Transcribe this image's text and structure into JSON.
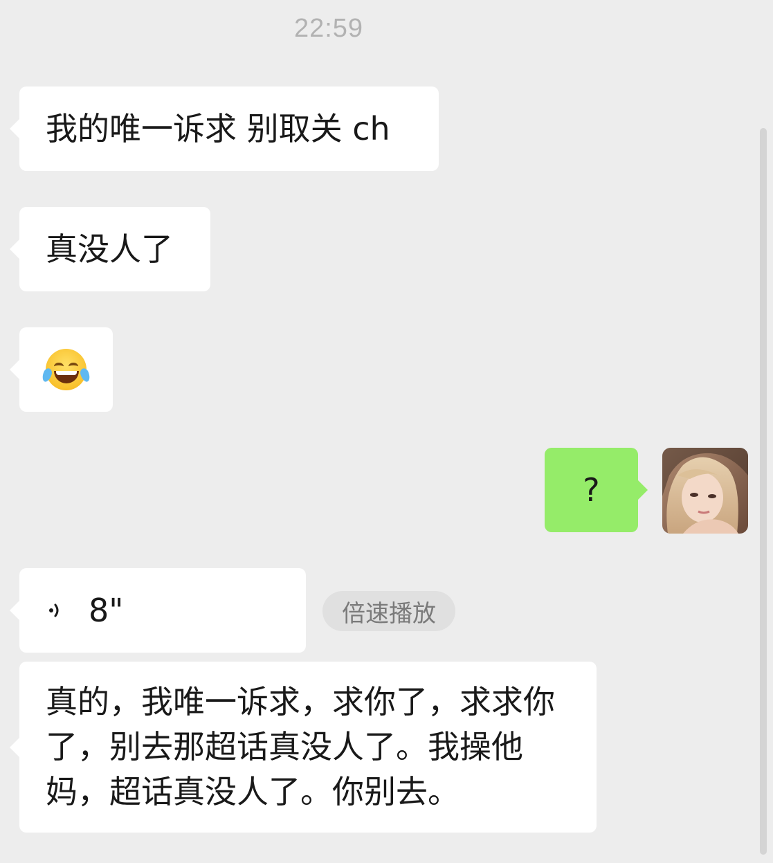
{
  "chat": {
    "timestamp": "22:59",
    "messages": [
      {
        "side": "left",
        "type": "text",
        "text": "我的唯一诉求 别取关 ch"
      },
      {
        "side": "left",
        "type": "text",
        "text": "真没人了"
      },
      {
        "side": "left",
        "type": "emoji",
        "emoji": "face-with-tears-of-joy"
      },
      {
        "side": "right",
        "type": "text",
        "text": "?"
      },
      {
        "side": "left",
        "type": "voice",
        "duration": "8\"",
        "speed_label": "倍速播放"
      },
      {
        "side": "left",
        "type": "text",
        "text": "真的，我唯一诉求，求你了，求求你了，别去那超话真没人了。我操他妈，超话真没人了。你别去。"
      }
    ]
  },
  "colors": {
    "background": "#ededed",
    "incoming_bubble": "#ffffff",
    "outgoing_bubble": "#95ec69",
    "timestamp": "#b2b2b2"
  }
}
